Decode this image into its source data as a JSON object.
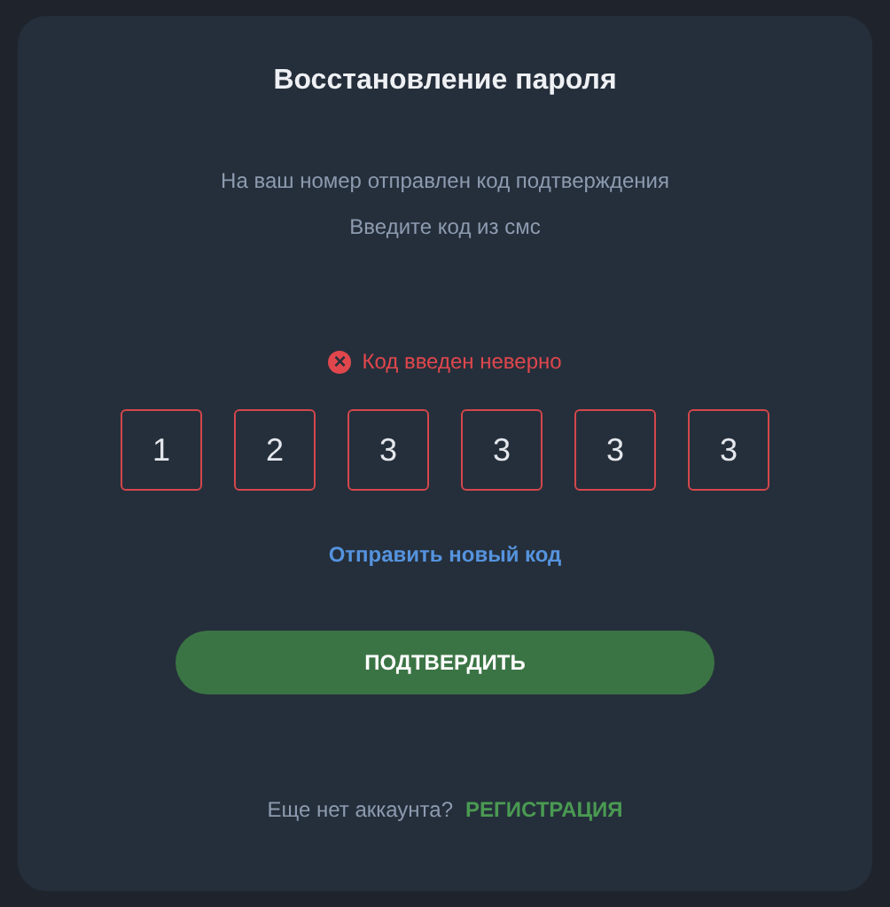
{
  "title": "Восстановление пароля",
  "messages": [
    "На ваш номер отправлен код подтверждения",
    "Введите код из смс"
  ],
  "error": {
    "icon": "×",
    "text": "Код введен неверно"
  },
  "code": {
    "invalid": true,
    "digits": [
      "1",
      "2",
      "3",
      "3",
      "3",
      "3"
    ]
  },
  "resend_link": "Отправить новый код",
  "confirm_button": "ПОДТВЕРДИТЬ",
  "footer": {
    "text": "Еще нет аккаунта?",
    "link": "РЕГИСТРАЦИЯ"
  }
}
